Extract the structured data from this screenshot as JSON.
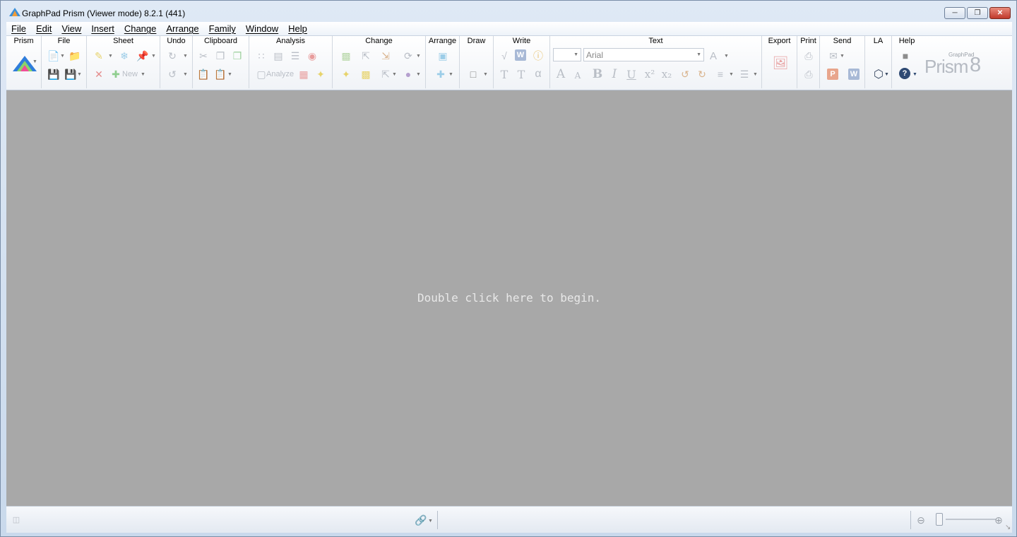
{
  "window": {
    "title": "GraphPad Prism (Viewer mode) 8.2.1 (441)",
    "controls": [
      "minimize",
      "restore",
      "close"
    ]
  },
  "menu": [
    {
      "label": "File"
    },
    {
      "label": "Edit"
    },
    {
      "label": "View"
    },
    {
      "label": "Insert"
    },
    {
      "label": "Change"
    },
    {
      "label": "Arrange"
    },
    {
      "label": "Family"
    },
    {
      "label": "Window"
    },
    {
      "label": "Help"
    }
  ],
  "toolbar": {
    "groups": {
      "prism": "Prism",
      "file": "File",
      "sheet": "Sheet",
      "undo": "Undo",
      "clipboard": "Clipboard",
      "analysis": "Analysis",
      "change": "Change",
      "arrange": "Arrange",
      "draw": "Draw",
      "write": "Write",
      "text": "Text",
      "export": "Export",
      "print": "Print",
      "send": "Send",
      "la": "LA",
      "help": "Help"
    },
    "new_label": "New",
    "analyze_label": "Analyze",
    "font_name": "Arial",
    "logo_small": "GraphPad",
    "logo_big": "Prism",
    "logo_num": "8",
    "colors": {
      "accent": "#3a6fc4",
      "disabled": "#b9bec6"
    }
  },
  "workspace": {
    "hint": "Double click here to begin."
  },
  "statusbar": {
    "zoom_icons": [
      "zoom-out-icon",
      "zoom-in-icon"
    ]
  }
}
